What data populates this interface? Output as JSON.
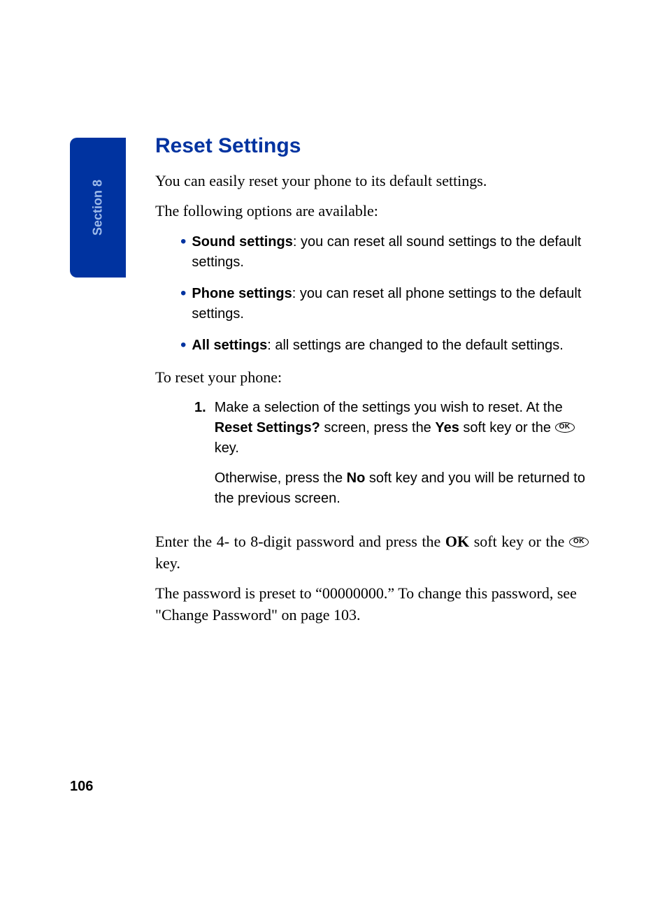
{
  "section_tab": "Section 8",
  "heading": "Reset Settings",
  "intro1": "You can easily reset your phone to its default settings.",
  "intro2": "The following options are available:",
  "bullets": [
    {
      "label": "Sound settings",
      "text": ": you can reset all sound settings to the default settings."
    },
    {
      "label": "Phone settings",
      "text": ": you can reset all phone settings to the default settings."
    },
    {
      "label": "All settings",
      "text": ": all settings are changed to the default settings."
    }
  ],
  "steps_intro": "To reset your phone:",
  "step1": {
    "marker": "1.",
    "p1_a": "Make a selection of the settings you wish to reset. At the ",
    "p1_b": "Reset Settings?",
    "p1_c": "  screen, press the ",
    "p1_d": "Yes",
    "p1_e": " soft key or the ",
    "p1_key": "OK",
    "p1_f": " key.",
    "p2_a": "Otherwise, press the ",
    "p2_b": "No",
    "p2_c": " soft key and you will be returned to the previous screen."
  },
  "post1_a": "Enter the 4- to 8-digit password and press the ",
  "post1_b": "OK",
  "post1_c": " soft key or the ",
  "post1_key": "OK",
  "post1_d": " key.",
  "post2": "The password is preset to “00000000.” To change this password, see \"Change Password\" on page 103.",
  "page_number": "106"
}
